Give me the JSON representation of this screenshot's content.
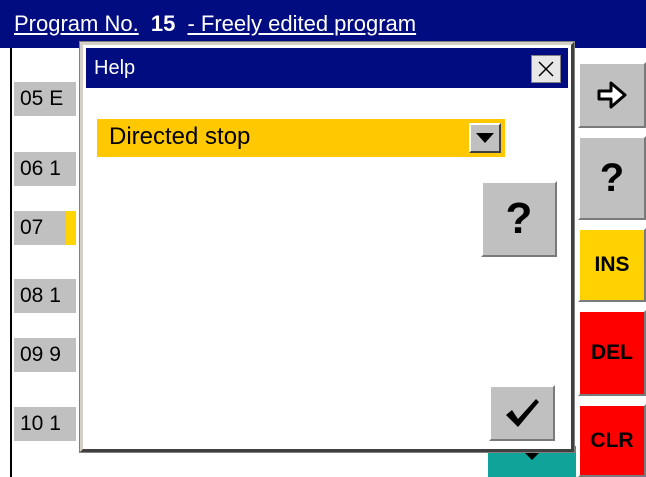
{
  "header": {
    "prefix": "Program No.",
    "number": "15",
    "name": "- Freely edited program"
  },
  "rows": [
    {
      "label": "05 E"
    },
    {
      "label": "06 1"
    },
    {
      "label": "07"
    },
    {
      "label": "08 1"
    },
    {
      "label": "09 9"
    },
    {
      "label": "10 1"
    }
  ],
  "side_buttons": {
    "enter_icon": "arrow-right-icon",
    "help_label": "?",
    "ins_label": "INS",
    "del_label": "DEL",
    "clr_label": "CLR"
  },
  "dialog": {
    "title": "Help",
    "close_icon": "close-icon",
    "selected_option": "Directed stop",
    "help_label": "?",
    "ok_icon": "checkmark-icon"
  },
  "colors": {
    "title_bar": "#000c80",
    "highlight": "#ffc800",
    "ins": "#ffd200",
    "del": "#ff0000",
    "teal": "#0fa39a"
  }
}
